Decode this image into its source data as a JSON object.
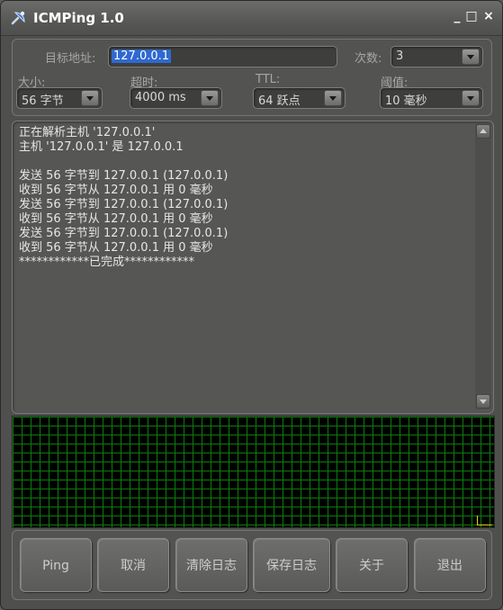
{
  "window": {
    "title": "ICMPing 1.0",
    "minimize_glyph": "_",
    "maximize_glyph": "□",
    "close_glyph": "×"
  },
  "settings": {
    "target_label": "目标地址:",
    "target_value": "127.0.0.1",
    "count_label": "次数:",
    "count_value": "3",
    "size_label": "大小:",
    "size_value": "56 字节",
    "timeout_label": "超时:",
    "timeout_value": "4000 ms",
    "ttl_label": "TTL:",
    "ttl_value": "64 跃点",
    "threshold_label": "阈值:",
    "threshold_value": "10 毫秒"
  },
  "log": {
    "lines": [
      "正在解析主机 '127.0.0.1'",
      "主机 '127.0.0.1' 是 127.0.0.1",
      "",
      "发送 56 字节到 127.0.0.1 (127.0.0.1)",
      "收到 56 字节从 127.0.0.1 用 0 毫秒",
      "发送 56 字节到 127.0.0.1 (127.0.0.1)",
      "收到 56 字节从 127.0.0.1 用 0 毫秒",
      "发送 56 字节到 127.0.0.1 (127.0.0.1)",
      "收到 56 字节从 127.0.0.1 用 0 毫秒",
      "************已完成************"
    ]
  },
  "buttons": {
    "ping": "Ping",
    "cancel": "取消",
    "clear_log": "清除日志",
    "save_log": "保存日志",
    "about": "关于",
    "exit": "退出"
  },
  "colors": {
    "graph_grid": "#0f7a0f",
    "graph_background": "#000000",
    "selection": "#2f69d0"
  },
  "icons": {
    "app": "satellite-dish-icon",
    "combo_arrow": "chevron-down-icon"
  }
}
